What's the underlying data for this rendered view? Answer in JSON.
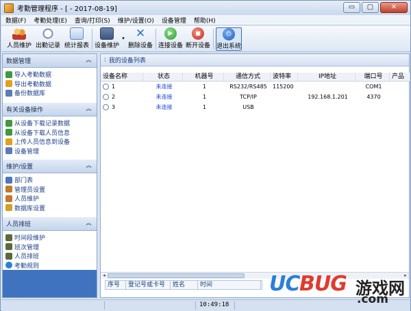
{
  "window": {
    "title": "考勤管理程序 - [ - 2017-08-19]",
    "buttons": {
      "minimize": "▭",
      "maximize": "▢",
      "close": "✕"
    }
  },
  "menu": {
    "items": [
      "数据(F)",
      "考勤处理(E)",
      "查询/打印(S)",
      "维护/设置(O)",
      "设备管理",
      "帮助(H)"
    ]
  },
  "toolbar": {
    "buttons": [
      {
        "label": "人员维护",
        "icon": "users-icon",
        "color": "#e8a53c"
      },
      {
        "label": "出勤记录",
        "icon": "clock-icon",
        "color": "#7a8fb0"
      },
      {
        "label": "统计报表",
        "icon": "report-icon",
        "color": "#5b86c7"
      },
      {
        "label": "设备维护",
        "icon": "device-icon",
        "color": "#4a6a9a"
      },
      {
        "label": "删除设备",
        "icon": "delete-icon",
        "color": "#2f6fd0"
      },
      {
        "label": "连接设备",
        "icon": "connect-icon",
        "color": "#3aa640"
      },
      {
        "label": "断开设备",
        "icon": "disconnect-icon",
        "color": "#d63a2a"
      },
      {
        "label": "退出系统",
        "icon": "exit-icon",
        "color": "#2a64c5"
      }
    ]
  },
  "sidebar": {
    "sections": [
      {
        "title": "数据管理",
        "items": [
          {
            "label": "导入考勤数据",
            "icon": "import-icon",
            "color": "#3f9a3f"
          },
          {
            "label": "导出考勤数据",
            "icon": "export-icon",
            "color": "#e0a020"
          },
          {
            "label": "备份数据库",
            "icon": "backup-icon",
            "color": "#5a7bb5"
          }
        ]
      },
      {
        "title": "有关设备操作",
        "items": [
          {
            "label": "从设备下载记录数据",
            "icon": "download-icon",
            "color": "#3f9a3f"
          },
          {
            "label": "从设备下载人员信息",
            "icon": "download-user-icon",
            "color": "#3f9a3f"
          },
          {
            "label": "上传人员信息到设备",
            "icon": "upload-icon",
            "color": "#e0a020"
          },
          {
            "label": "设备管理",
            "icon": "device-manage-icon",
            "color": "#5a7bb5"
          }
        ]
      },
      {
        "title": "维护/设置",
        "items": [
          {
            "label": "部门表",
            "icon": "department-icon",
            "color": "#4f77b8"
          },
          {
            "label": "管理员设置",
            "icon": "admin-icon",
            "color": "#c07a2a"
          },
          {
            "label": "人员维护",
            "icon": "user-icon",
            "color": "#c07a2a"
          },
          {
            "label": "数据库设置",
            "icon": "database-icon",
            "color": "#d4a020"
          }
        ]
      },
      {
        "title": "人员排班",
        "items": [
          {
            "label": "时间段维护",
            "icon": "time-icon",
            "color": "#5a6a3a"
          },
          {
            "label": "班次管理",
            "icon": "shift-icon",
            "color": "#5a6a3a"
          },
          {
            "label": "人员排班",
            "icon": "schedule-icon",
            "color": "#5a6a3a"
          },
          {
            "label": "考勤规则",
            "icon": "rule-icon",
            "color": "#2a7fd9"
          }
        ]
      }
    ]
  },
  "main": {
    "title": "我的设备列表",
    "columns": [
      "设备名称",
      "状态",
      "机器号",
      "通信方式",
      "波特率",
      "IP地址",
      "端口号",
      "产品"
    ],
    "rows": [
      [
        "1",
        "未连接",
        "1",
        "RS232/RS485",
        "115200",
        "",
        "COM1",
        ""
      ],
      [
        "2",
        "未连接",
        "1",
        "TCP/IP",
        "",
        "192.168.1.201",
        "4370",
        ""
      ],
      [
        "3",
        "未连接",
        "1",
        "USB",
        "",
        "",
        "",
        ""
      ]
    ],
    "bottom_columns": [
      "序号",
      "登记号或卡号",
      "姓名",
      "时间"
    ]
  },
  "status": {
    "time": "10:49:18"
  },
  "watermark": {
    "uc": "UC",
    "bug": "BUG",
    "cn": "游戏网",
    "com": ".com"
  }
}
